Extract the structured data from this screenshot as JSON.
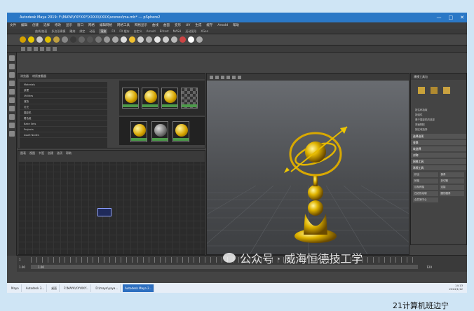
{
  "window": {
    "title": "Autodesk Maya 2019: F:\\MAYA\\YXYXXY\\XXXX\\XXXX\\scenes\\ma.mb* --- pSphere2",
    "controls": [
      "—",
      "□",
      "✕"
    ]
  },
  "menubar": {
    "items": [
      "文件",
      "编辑",
      "创建",
      "选择",
      "修改",
      "显示",
      "窗口",
      "网格",
      "编辑网格",
      "网格工具",
      "网格显示",
      "曲线",
      "曲面",
      "变形",
      "UV",
      "生成",
      "缓存",
      "Arnold",
      "帮助"
    ]
  },
  "shelf_tabs": [
    "曲线/曲面",
    "多边形建模",
    "雕刻",
    "绑定",
    "动画",
    "渲染",
    "FX",
    "FX 缓存",
    "自定义",
    "Arnold",
    "Bifrost",
    "MASH",
    "运动图形",
    "XGen"
  ],
  "shelf_icon_colors": [
    "#d4a000",
    "#e8c800",
    "#c8c8c8",
    "#e0c000",
    "#c0a040",
    "#888",
    "#3a3a3a",
    "#666",
    "#555",
    "#777",
    "#999",
    "#aaa",
    "#ddd",
    "#f0c030",
    "#d0d0d0",
    "#b0b0b0",
    "#e6e6e6",
    "#ccc",
    "#bbb",
    "#c44",
    "#fff",
    "#aaa"
  ],
  "hypershade": {
    "tabs": [
      "浏览器",
      "材质查看器"
    ],
    "list_items": [
      "Materials",
      "纹理",
      "Utilities",
      "渲染",
      "灯光",
      "摄影机",
      "着色组",
      "Bake Sets",
      "Projects",
      "Asset Nodes"
    ],
    "swatch_tabs": [
      "材质",
      "纹理",
      "工具",
      "渲染",
      "灯光",
      "摄影机"
    ]
  },
  "node_editor": {
    "tabs": [
      "图表",
      "视图",
      "书签",
      "创建",
      "选项",
      "帮助"
    ]
  },
  "attribute_editor": {
    "title": "建模工具包",
    "sections": [
      "选择选项",
      "变换",
      "软选择",
      "对称",
      "网格工具",
      "常规工具"
    ],
    "rows": [
      "按名称拾取",
      "按组件",
      "基于摄影机的选择",
      "背面剔除",
      "按区域选择"
    ],
    "tool_buttons": [
      "挤出",
      "倒角",
      "桥接",
      "多切割",
      "目标焊接",
      "连接",
      "四边形绘制",
      "圆形圆角",
      "合并到中心"
    ]
  },
  "timeline": {
    "start": "1.00",
    "end": "1.00",
    "range_end": "120",
    "frame": "1"
  },
  "taskbar": {
    "items": [
      "Maya",
      "Autodesk 3...",
      "桌面",
      "F:\\MAYA\\YXYXXY...",
      "D:\\maya\\yaya...",
      "Autodesk Maya 2..."
    ],
    "time": "14:13",
    "date": "2024/1/12"
  },
  "watermark": "公众号 · 威海恒德技工学",
  "caption": "21计算机班边宁"
}
